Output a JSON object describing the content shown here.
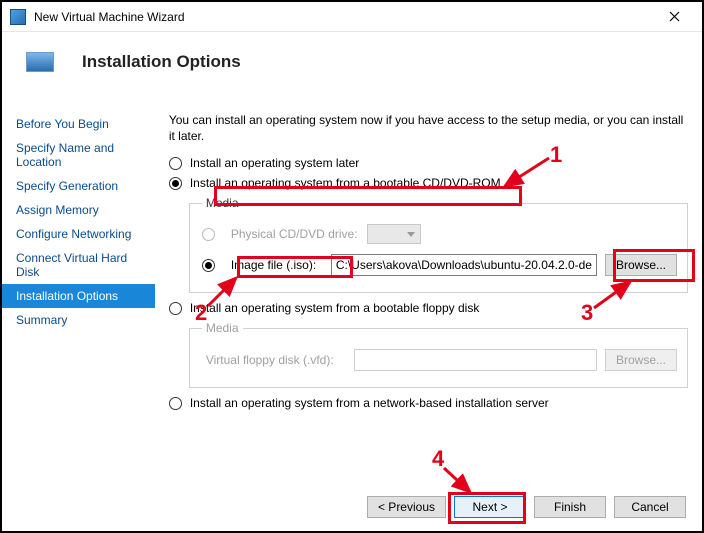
{
  "titlebar": {
    "title": "New Virtual Machine Wizard"
  },
  "header": {
    "title": "Installation Options"
  },
  "sidebar": {
    "items": [
      {
        "label": "Before You Begin"
      },
      {
        "label": "Specify Name and Location"
      },
      {
        "label": "Specify Generation"
      },
      {
        "label": "Assign Memory"
      },
      {
        "label": "Configure Networking"
      },
      {
        "label": "Connect Virtual Hard Disk"
      },
      {
        "label": "Installation Options"
      },
      {
        "label": "Summary"
      }
    ]
  },
  "content": {
    "intro": "You can install an operating system now if you have access to the setup media, or you can install it later.",
    "opt_later": "Install an operating system later",
    "opt_cd": "Install an operating system from a bootable CD/DVD-ROM",
    "media1_legend": "Media",
    "physical_label": "Physical CD/DVD drive:",
    "image_label": "Image file (.iso):",
    "image_path": "C:\\Users\\akova\\Downloads\\ubuntu-20.04.2.0-de",
    "browse1": "Browse...",
    "opt_floppy": "Install an operating system from a bootable floppy disk",
    "media2_legend": "Media",
    "vfd_label": "Virtual floppy disk (.vfd):",
    "browse2": "Browse...",
    "opt_network": "Install an operating system from a network-based installation server"
  },
  "footer": {
    "previous": "< Previous",
    "next": "Next >",
    "finish": "Finish",
    "cancel": "Cancel"
  },
  "annotations": {
    "l1": "1",
    "l2": "2",
    "l3": "3",
    "l4": "4"
  }
}
